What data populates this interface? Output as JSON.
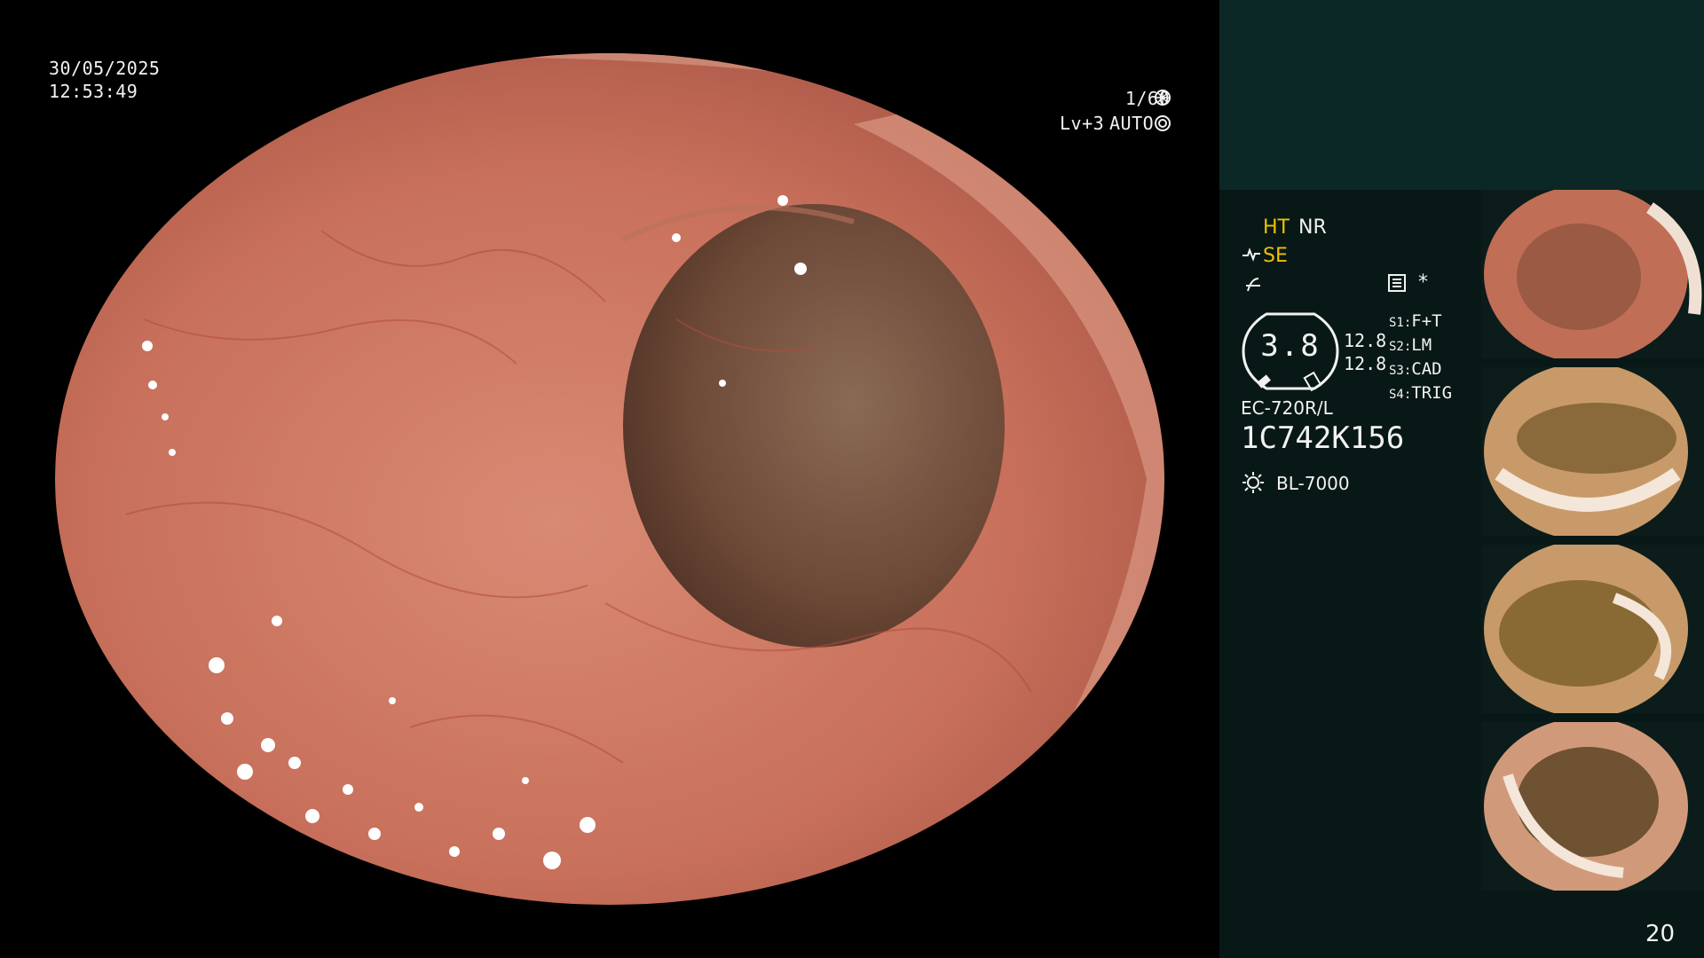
{
  "overlay": {
    "date": "30/05/2025",
    "time": "12:53:49",
    "shutter": "1/60",
    "level": "Lv+3",
    "mode": "AUTO"
  },
  "settings": {
    "ht": "HT",
    "nr": "NR",
    "se": "SE",
    "star": "*"
  },
  "gauge": {
    "value": "3.8",
    "left_val_1": "12.8",
    "left_val_2": "12.8"
  },
  "switches": [
    {
      "key": "S1:",
      "value": "F+T"
    },
    {
      "key": "S2:",
      "value": "LM"
    },
    {
      "key": "S3:",
      "value": "CAD"
    },
    {
      "key": "S4:",
      "value": "TRIG"
    }
  ],
  "scope": {
    "model": "EC-720R/L",
    "serial": "1C742K156",
    "light_source": "BL-7000"
  },
  "thumbnails_count": 4,
  "page_number": "20",
  "colors": {
    "panel_top": "#0c2826",
    "panel": "#081816",
    "accent_yellow": "#f0c000"
  },
  "icons": [
    "shutter-icon",
    "auto-iris-icon",
    "se-icon",
    "sharpness-icon",
    "menu-icon",
    "light-source-icon"
  ]
}
